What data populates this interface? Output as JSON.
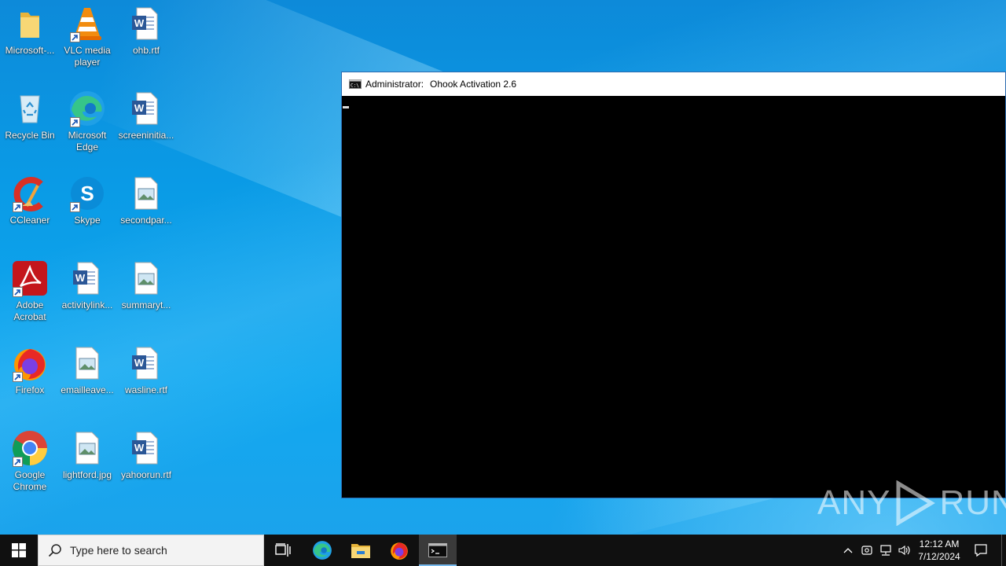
{
  "desktop": {
    "icons": [
      {
        "label": "Microsoft-...",
        "icon": "folder-icon"
      },
      {
        "label": "VLC media player",
        "icon": "vlc-icon"
      },
      {
        "label": "ohb.rtf",
        "icon": "word-doc-icon"
      },
      {
        "label": "Recycle Bin",
        "icon": "recycle-bin-icon"
      },
      {
        "label": "Microsoft Edge",
        "icon": "edge-icon"
      },
      {
        "label": "screeninitia...",
        "icon": "word-doc-icon"
      },
      {
        "label": "CCleaner",
        "icon": "ccleaner-icon"
      },
      {
        "label": "Skype",
        "icon": "skype-icon"
      },
      {
        "label": "secondpar...",
        "icon": "image-file-icon"
      },
      {
        "label": "Adobe Acrobat",
        "icon": "acrobat-icon"
      },
      {
        "label": "activitylink...",
        "icon": "word-doc-icon"
      },
      {
        "label": "summaryt...",
        "icon": "image-file-icon"
      },
      {
        "label": "Firefox",
        "icon": "firefox-icon"
      },
      {
        "label": "emailleave...",
        "icon": "image-file-icon"
      },
      {
        "label": "wasline.rtf",
        "icon": "word-doc-icon"
      },
      {
        "label": "Google Chrome",
        "icon": "chrome-icon"
      },
      {
        "label": "lightford.jpg",
        "icon": "image-file-icon"
      },
      {
        "label": "yahoorun.rtf",
        "icon": "word-doc-icon"
      }
    ]
  },
  "console": {
    "title_prefix": "Administrator:",
    "title": "Ohook Activation 2.6",
    "icon": "cmd-icon"
  },
  "watermark": {
    "left": "ANY",
    "right": "RUN"
  },
  "taskbar": {
    "search_placeholder": "Type here to search",
    "time": "12:12 AM",
    "date": "7/12/2024",
    "colors": {
      "background": "#101010",
      "active_indicator": "#76b9ed"
    }
  }
}
